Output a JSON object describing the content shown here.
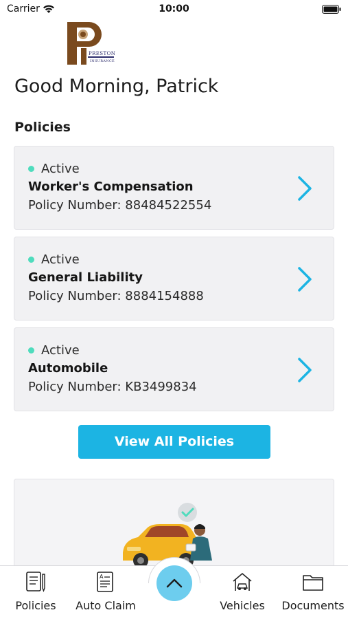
{
  "status_bar": {
    "carrier": "Carrier",
    "time": "10:00",
    "icons": [
      "wifi-icon",
      "battery-icon"
    ]
  },
  "logo": {
    "line1": "PRESTON",
    "line2": "INSURANCE",
    "colors": {
      "brown": "#7a4a1e",
      "navy": "#2b2b6b"
    }
  },
  "greeting": "Good Morning, Patrick",
  "policies_section": {
    "title": "Policies",
    "items": [
      {
        "status": "Active",
        "name": "Worker's Compensation",
        "number_label": "Policy Number:",
        "number": "88484522554"
      },
      {
        "status": "Active",
        "name": "General Liability",
        "number_label": "Policy Number:",
        "number": "8884154888"
      },
      {
        "status": "Active",
        "name": "Automobile",
        "number_label": "Policy Number:",
        "number": "KB3499834"
      }
    ],
    "view_all_label": "View All Policies"
  },
  "bottom_nav": {
    "items": [
      {
        "label": "Policies",
        "icon": "document-pen-icon"
      },
      {
        "label": "Auto Claim",
        "icon": "claim-form-icon"
      },
      {
        "label": "Vehicles",
        "icon": "car-house-icon"
      },
      {
        "label": "Documents",
        "icon": "folder-icon"
      }
    ],
    "center_icon": "chevron-up-icon"
  },
  "colors": {
    "accent": "#1cb4e3",
    "active_dot": "#4fdcbd",
    "center_button": "#6dcdee",
    "card_bg": "#f1f1f3"
  }
}
